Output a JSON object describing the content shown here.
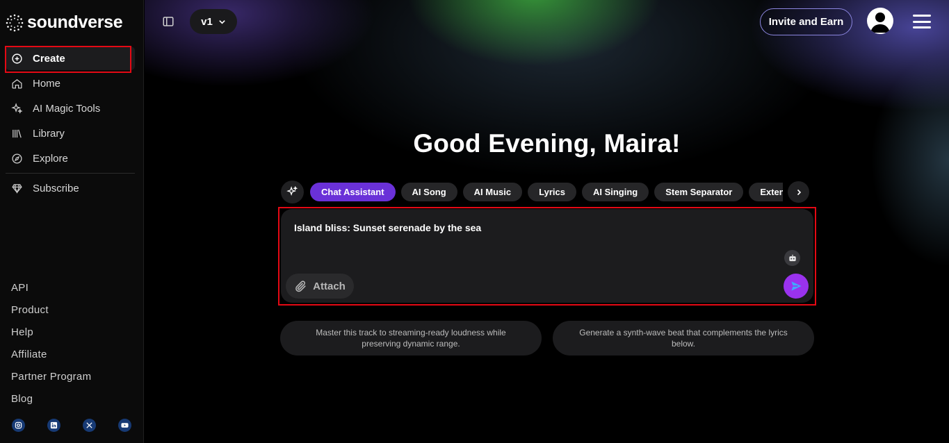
{
  "app": {
    "brand": "soundverse"
  },
  "sidebar": {
    "nav": [
      {
        "label": "Create",
        "icon": "plus-circle-icon",
        "active": true
      },
      {
        "label": "Home",
        "icon": "home-icon"
      },
      {
        "label": "AI Magic Tools",
        "icon": "sparkles-icon"
      },
      {
        "label": "Library",
        "icon": "library-icon"
      },
      {
        "label": "Explore",
        "icon": "compass-icon"
      }
    ],
    "subscribe": {
      "label": "Subscribe",
      "icon": "diamond-icon"
    },
    "footer_links": [
      "API",
      "Product",
      "Help",
      "Affiliate",
      "Partner Program",
      "Blog"
    ],
    "socials": [
      "instagram-icon",
      "linkedin-icon",
      "x-icon",
      "youtube-icon"
    ]
  },
  "header": {
    "version": "v1",
    "invite_label": "Invite and Earn"
  },
  "main": {
    "greeting": "Good Evening, Maira!",
    "tabs": [
      "Chat Assistant",
      "AI Song",
      "AI Music",
      "Lyrics",
      "AI Singing",
      "Stem Separator",
      "Extend"
    ],
    "active_tab": "Chat Assistant",
    "prompt": {
      "value": "Island bliss: Sunset serenade by the sea",
      "attach_label": "Attach"
    },
    "suggestions": [
      "Master this track to streaming-ready loudness while preserving dynamic range.",
      "Generate a synth-wave beat that complements the lyrics below."
    ]
  },
  "colors": {
    "accent": "#6a31d8",
    "send_button": "#9a32ee",
    "highlight_box": "#e50914",
    "invite_border": "#8c86e0"
  }
}
